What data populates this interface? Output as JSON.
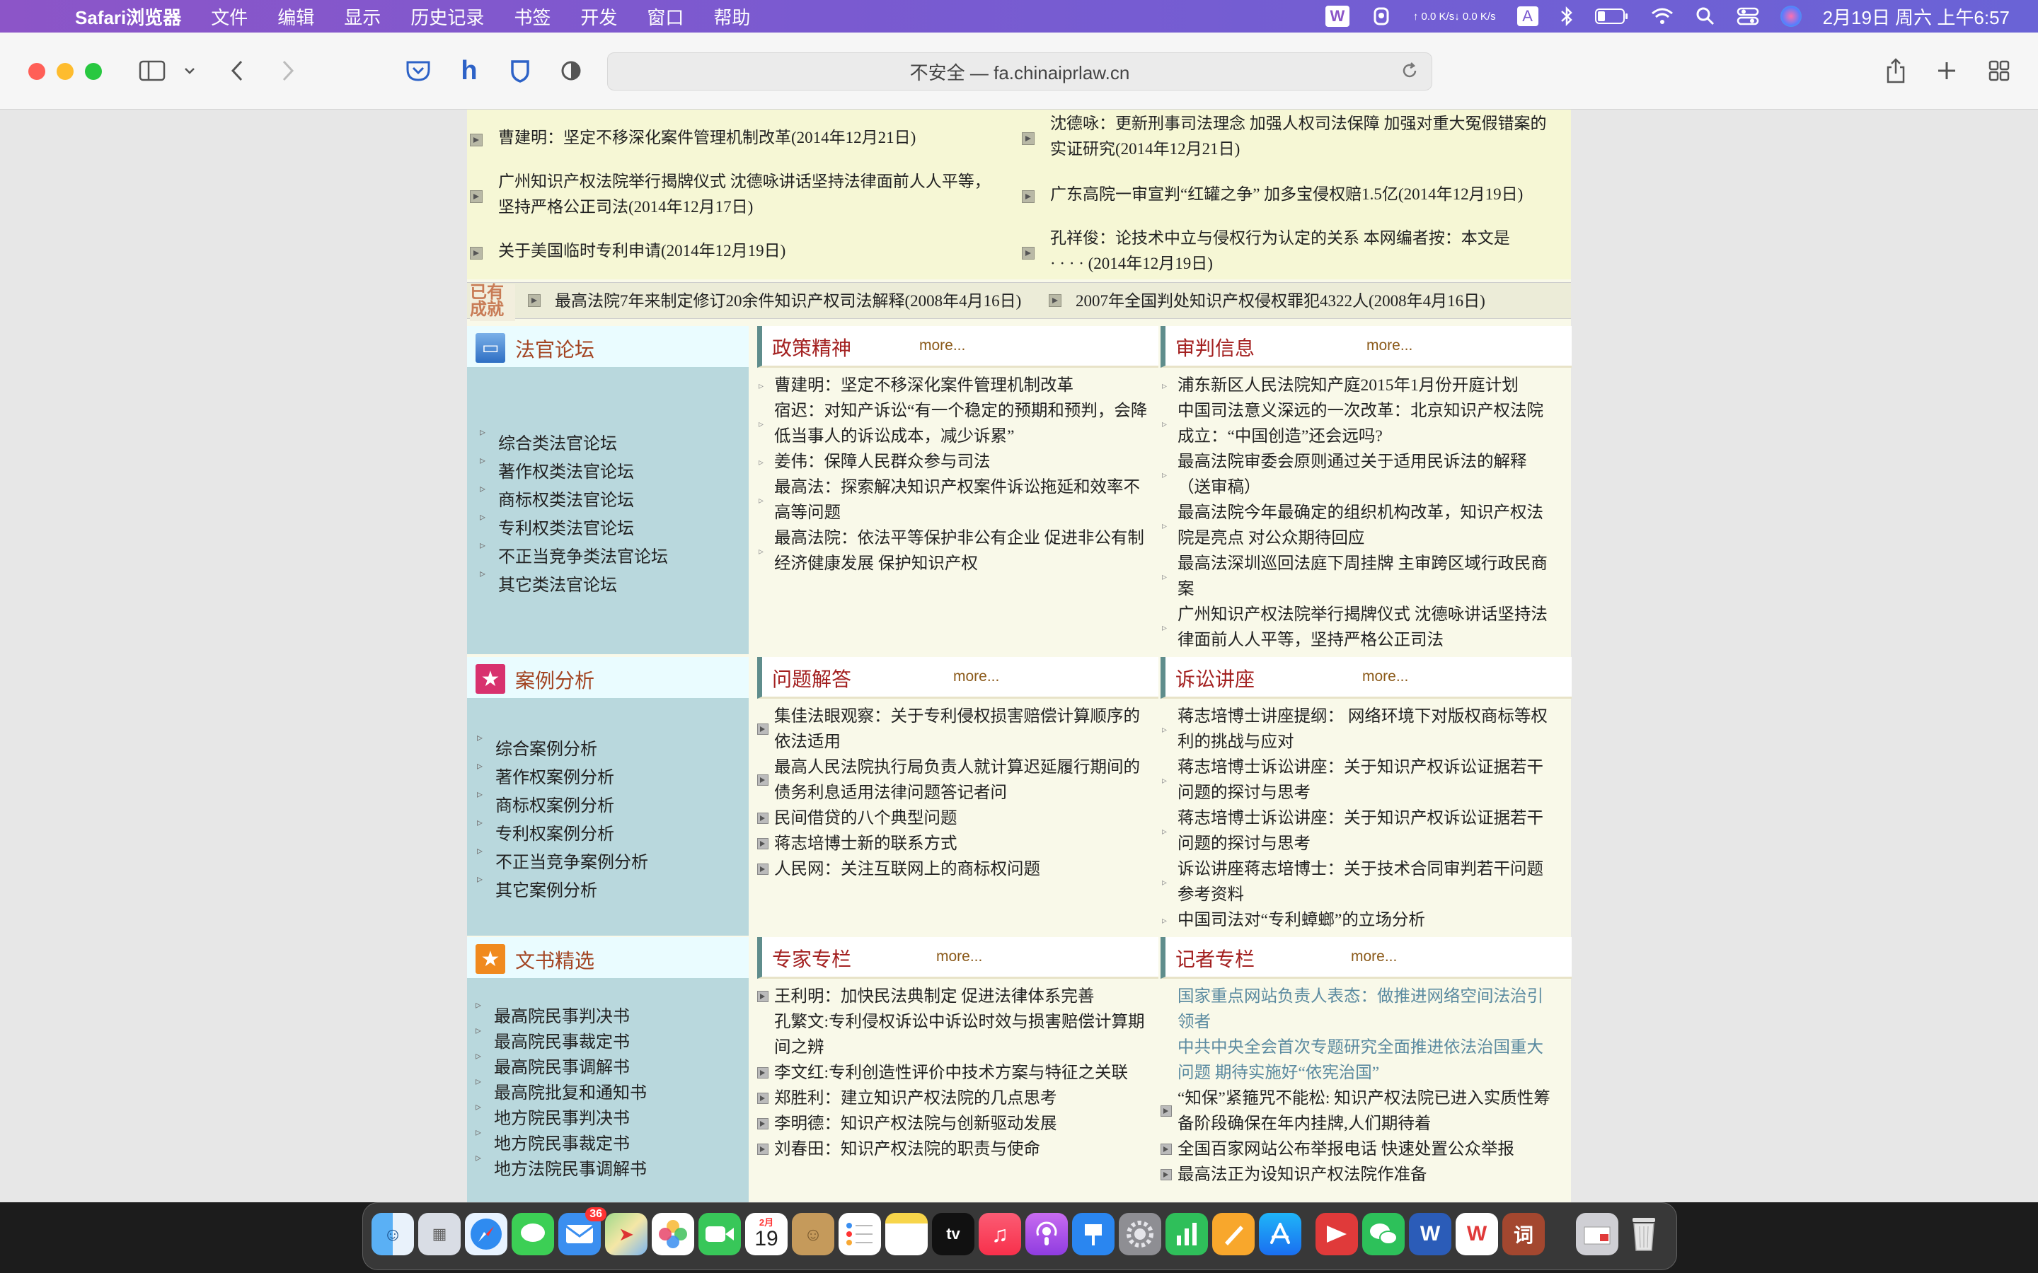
{
  "menubar": {
    "app_name": "Safari浏览器",
    "menus": [
      "文件",
      "编辑",
      "显示",
      "历史记录",
      "书签",
      "开发",
      "窗口",
      "帮助"
    ],
    "net_up": "↑ 0.0 K/s",
    "net_down": "↓ 0.0 K/s",
    "input_method": "A",
    "datetime": "2月19日 周六 上午6:57"
  },
  "toolbar": {
    "url": "不安全 — fa.chinaiprlaw.cn"
  },
  "top_news": {
    "left": [
      "曹建明：坚定不移深化案件管理机制改革(2014年12月21日)",
      "广州知识产权法院举行揭牌仪式 沈德咏讲话坚持法律面前人人平等，",
      "坚持严格公正司法(2014年12月17日)",
      "关于美国临时专利申请(2014年12月19日)"
    ],
    "right": [
      "沈德咏：更新刑事司法理念 加强人权司法保障 加强对重大冤假错案的",
      "实证研究(2014年12月21日)",
      "广东高院一审宣判“红罐之争” 加多宝侵权赔1.5亿(2014年12月19日)",
      "孔祥俊：论技术中立与侵权行为认定的关系 本网编者按：本文是",
      "· · · · (2014年12月19日)"
    ]
  },
  "ticker": {
    "logo_line1": "已有",
    "logo_line2": "成就",
    "item1": "最高法院7年来制定修订20余件知识产权司法解释(2008年4月16日)",
    "item2": "2007年全国判处知识产权侵权罪犯4322人(2008年4月16日)"
  },
  "more_label": "more...",
  "section1": {
    "side_title": "法官论坛",
    "side_links": [
      "综合类法官论坛",
      "著作权类法官论坛",
      "商标权类法官论坛",
      "专利权类法官论坛",
      "不正当竞争类法官论坛",
      "其它类法官论坛"
    ],
    "col1_title": "政策精神",
    "col1_lines": [
      "曹建明：坚定不移深化案件管理机制改革",
      "宿迟：对知产诉讼“有一个稳定的预期和预判，会降",
      "低当事人的诉讼成本，减少诉累”",
      "姜伟：保障人民群众参与司法",
      "最高法：探索解决知识产权案件诉讼拖延和效率不",
      "高等问题",
      "最高法院：依法平等保护非公有企业 促进非公有制",
      "经济健康发展 保护知识产权"
    ],
    "col2_title": "审判信息",
    "col2_lines": [
      "浦东新区人民法院知产庭2015年1月份开庭计划",
      "中国司法意义深远的一次改革：北京知识产权法院",
      "成立：“中国创造”还会远吗?",
      "最高法院审委会原则通过关于适用民诉法的解释",
      "（送审稿）",
      "最高法院今年最确定的组织机构改革，知识产权法",
      "院是亮点 对公众期待回应",
      "最高法深圳巡回法庭下周挂牌 主审跨区域行政民商",
      "案",
      "广州知识产权法院举行揭牌仪式 沈德咏讲话坚持法",
      "律面前人人平等，坚持严格公正司法"
    ]
  },
  "section2": {
    "side_title": "案例分析",
    "side_links": [
      "综合案例分析",
      "著作权案例分析",
      "商标权案例分析",
      "专利权案例分析",
      "不正当竞争案例分析",
      "其它案例分析"
    ],
    "col1_title": "问题解答",
    "col1_lines": [
      "集佳法眼观察：关于专利侵权损害赔偿计算顺序的",
      "依法适用",
      "最高人民法院执行局负责人就计算迟延履行期间的",
      "债务利息适用法律问题答记者问",
      "民间借贷的八个典型问题",
      "蒋志培博士新的联系方式",
      "人民网：关注互联网上的商标权问题"
    ],
    "col2_title": "诉讼讲座",
    "col2_lines": [
      "蒋志培博士讲座提纲： 网络环境下对版权商标等权",
      "利的挑战与应对",
      "蒋志培博士诉讼讲座：关于知识产权诉讼证据若干",
      "问题的探讨与思考",
      "蒋志培博士诉讼讲座：关于知识产权诉讼证据若干",
      "问题的探讨与思考",
      "诉讼讲座蒋志培博士：关于技术合同审判若干问题",
      "参考资料",
      "中国司法对“专利蟑螂”的立场分析"
    ]
  },
  "section3": {
    "side_title": "文书精选",
    "side_links": [
      "最高院民事判决书",
      "最高院民事裁定书",
      "最高院民事调解书",
      "最高院批复和通知书",
      "地方院民事判决书",
      "地方院民事裁定书",
      "地方法院民事调解书"
    ],
    "col1_title": "专家专栏",
    "col1_lines": [
      "王利明：加快民法典制定 促进法律体系完善",
      "孔繁文:专利侵权诉讼中诉讼时效与损害赔偿计算期",
      "间之辨",
      "李文红:专利创造性评价中技术方案与特征之关联",
      "郑胜利：建立知识产权法院的几点思考",
      "李明德：知识产权法院与创新驱动发展",
      "刘春田：知识产权法院的职责与使命"
    ],
    "col2_title": "记者专栏",
    "col2_lines": [
      "国家重点网站负责人表态：做推进网络空间法治引",
      "领者",
      "中共中央全会首次专题研究全面推进依法治国重大",
      "问题 期待实施好“依宪治国”",
      "“知保”紧箍咒不能松: 知识产权法院已进入实质性筹",
      "备阶段确保在年内挂牌,人们期待着",
      "全国百家网站公布举报电话 快速处置公众举报",
      "最高法正为设知识产权法院作准备"
    ]
  },
  "dock": {
    "calendar_month": "2月",
    "calendar_day": "19",
    "mail_badge": "36",
    "tv_label": "tv",
    "word_label": "W",
    "wps_label": "W",
    "dict_label": "词"
  },
  "colors": {
    "menubar": "#8c55c8",
    "section_title": "#a32020",
    "sidebar_bg": "#b9d8dd",
    "news_bg": "#f6f7d5"
  }
}
